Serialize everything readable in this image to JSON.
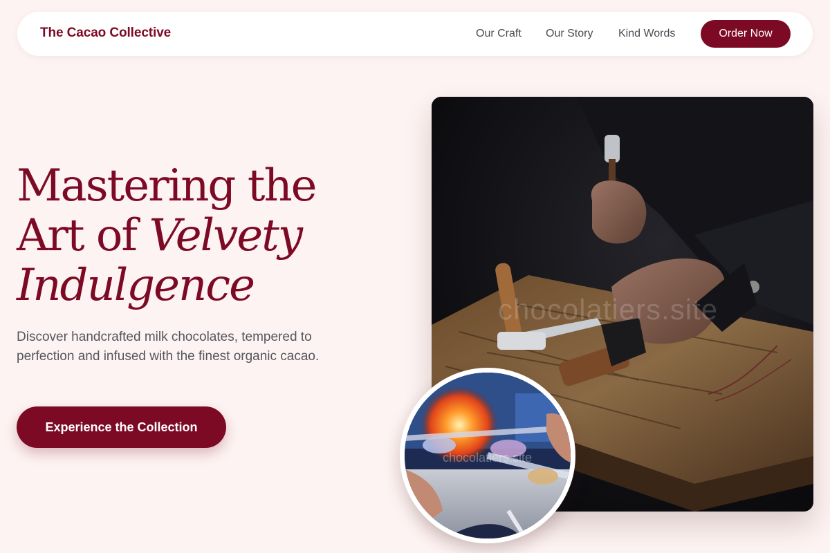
{
  "nav": {
    "brand": "The Cacao Collective",
    "links": [
      "Our Craft",
      "Our Story",
      "Kind Words"
    ],
    "order_label": "Order Now"
  },
  "hero": {
    "headline_line1": "Mastering the",
    "headline_line2_plain": "Art of ",
    "headline_line2_italic": "Velvety",
    "headline_line3_italic": "Indulgence",
    "subtext": "Discover handcrafted milk chocolates, tempered to perfection and infused with the finest organic cacao.",
    "cta_label": "Experience the Collection"
  },
  "images": {
    "main_watermark": "chocolatiers.site",
    "inset_watermark": "chocolatiers.site"
  },
  "colors": {
    "brand": "#7d0a25",
    "background": "#fdf3f2",
    "nav_background": "#ffffff",
    "body_text": "#55555e"
  }
}
